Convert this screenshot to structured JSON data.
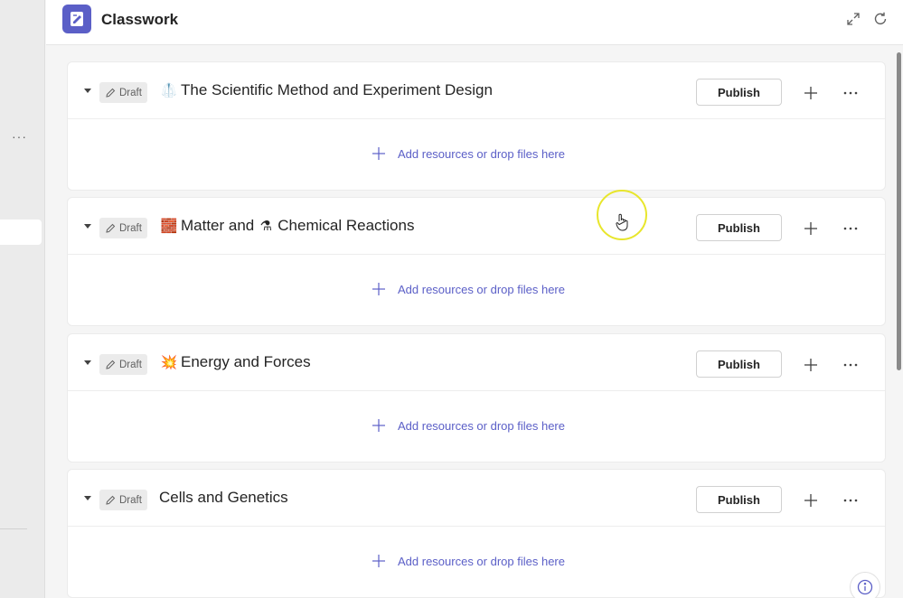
{
  "app": {
    "title": "Classwork",
    "icon": "classwork-notebook-icon",
    "brand_color": "#5b5fc7"
  },
  "toolbar": {
    "expand_icon": "expand-icon",
    "refresh_icon": "refresh-icon"
  },
  "left_rail": {
    "more_label": "···"
  },
  "modules": [
    {
      "status": "Draft",
      "emoji1": "🥼",
      "part1": "The Scientific Method and Experiment Design",
      "emoji2": "",
      "part2": "",
      "publish_label": "Publish",
      "add_resources_label": "Add resources or drop files here"
    },
    {
      "status": "Draft",
      "emoji1": "🧱",
      "part1": "Matter and",
      "emoji2": "⚗",
      "part2": "Chemical Reactions",
      "publish_label": "Publish",
      "add_resources_label": "Add resources or drop files here"
    },
    {
      "status": "Draft",
      "emoji1": "💥",
      "part1": "Energy and Forces",
      "emoji2": "",
      "part2": "",
      "publish_label": "Publish",
      "add_resources_label": "Add resources or drop files here"
    },
    {
      "status": "Draft",
      "emoji1": "",
      "part1": "Cells and Genetics",
      "emoji2": "",
      "part2": "",
      "publish_label": "Publish",
      "add_resources_label": "Add resources or drop files here"
    }
  ]
}
